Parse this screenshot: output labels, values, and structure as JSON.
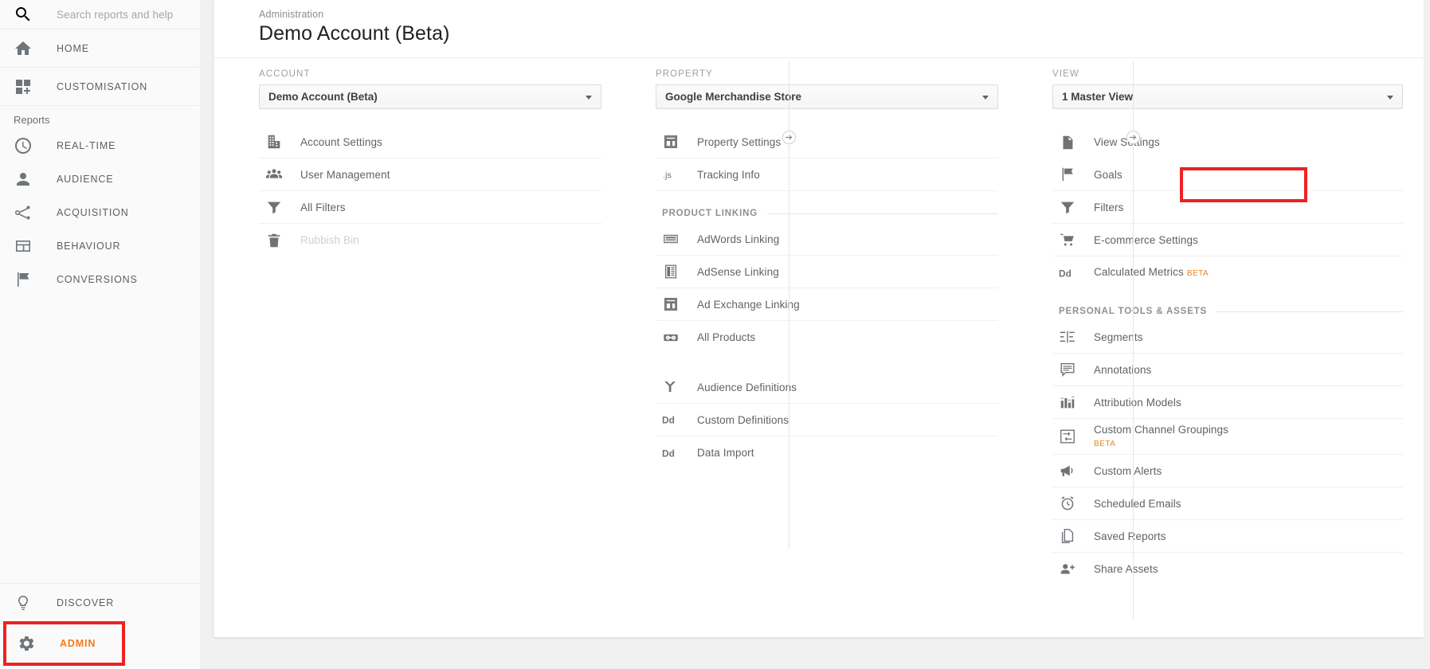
{
  "sidebar": {
    "search": {
      "placeholder": "Search reports and help",
      "icon": "search-icon"
    },
    "top_items": [
      {
        "label": "HOME",
        "icon": "home-icon"
      },
      {
        "label": "CUSTOMISATION",
        "icon": "customisation-icon"
      }
    ],
    "reports_label": "Reports",
    "report_items": [
      {
        "label": "REAL-TIME",
        "icon": "clock-icon"
      },
      {
        "label": "AUDIENCE",
        "icon": "person-icon"
      },
      {
        "label": "ACQUISITION",
        "icon": "acquisition-icon"
      },
      {
        "label": "BEHAVIOUR",
        "icon": "behaviour-icon"
      },
      {
        "label": "CONVERSIONS",
        "icon": "flag-icon"
      }
    ],
    "bottom_items": [
      {
        "label": "DISCOVER",
        "icon": "lightbulb-icon"
      }
    ],
    "admin": {
      "label": "ADMIN",
      "icon": "gear-icon",
      "highlighted": true,
      "color": "#f47a20"
    }
  },
  "header": {
    "breadcrumb": "Administration",
    "title": "Demo Account (Beta)"
  },
  "columns": {
    "account": {
      "heading": "ACCOUNT",
      "selected": "Demo Account (Beta)",
      "items": [
        {
          "label": "Account Settings",
          "icon": "building-icon",
          "disabled": false
        },
        {
          "label": "User Management",
          "icon": "people-icon",
          "disabled": false
        },
        {
          "label": "All Filters",
          "icon": "funnel-icon",
          "disabled": false
        },
        {
          "label": "Rubbish Bin",
          "icon": "trash-icon",
          "disabled": true
        }
      ]
    },
    "property": {
      "heading": "PROPERTY",
      "selected": "Google Merchandise Store",
      "items": [
        {
          "label": "Property Settings",
          "icon": "window-icon",
          "disabled": false
        },
        {
          "label": "Tracking Info",
          "icon": "js-icon",
          "disabled": false
        }
      ],
      "group_heading": "PRODUCT LINKING",
      "group_items": [
        {
          "label": "AdWords Linking",
          "icon": "adwords-icon"
        },
        {
          "label": "AdSense Linking",
          "icon": "adsense-icon"
        },
        {
          "label": "Ad Exchange Linking",
          "icon": "window-icon"
        },
        {
          "label": "All Products",
          "icon": "link-icon"
        }
      ],
      "tail_items": [
        {
          "label": "Audience Definitions",
          "icon": "audience-def-icon"
        },
        {
          "label": "Custom Definitions",
          "icon": "dd-icon"
        },
        {
          "label": "Data Import",
          "icon": "dd-icon"
        }
      ]
    },
    "view": {
      "heading": "VIEW",
      "selected": "1 Master View",
      "items": [
        {
          "label": "View Settings",
          "icon": "document-icon",
          "highlighted": true
        },
        {
          "label": "Goals",
          "icon": "flag-icon"
        },
        {
          "label": "Filters",
          "icon": "funnel-icon"
        },
        {
          "label": "E-commerce Settings",
          "icon": "cart-icon"
        },
        {
          "label": "Calculated Metrics",
          "icon": "dd-icon",
          "badge": "BETA"
        }
      ],
      "group_heading": "PERSONAL TOOLS & ASSETS",
      "group_items": [
        {
          "label": "Segments",
          "icon": "segments-icon"
        },
        {
          "label": "Annotations",
          "icon": "annotation-icon"
        },
        {
          "label": "Attribution Models",
          "icon": "bars-icon"
        },
        {
          "label": "Custom Channel Groupings",
          "icon": "channel-grouping-icon",
          "badge": "BETA",
          "badge_block": true
        },
        {
          "label": "Custom Alerts",
          "icon": "megaphone-icon"
        },
        {
          "label": "Scheduled Emails",
          "icon": "alarm-icon"
        },
        {
          "label": "Saved Reports",
          "icon": "copy-doc-icon"
        },
        {
          "label": "Share Assets",
          "icon": "person-add-icon"
        }
      ]
    }
  },
  "colors": {
    "highlight": "#ee2222",
    "accent": "#f47a20",
    "beta": "#ef8421"
  }
}
